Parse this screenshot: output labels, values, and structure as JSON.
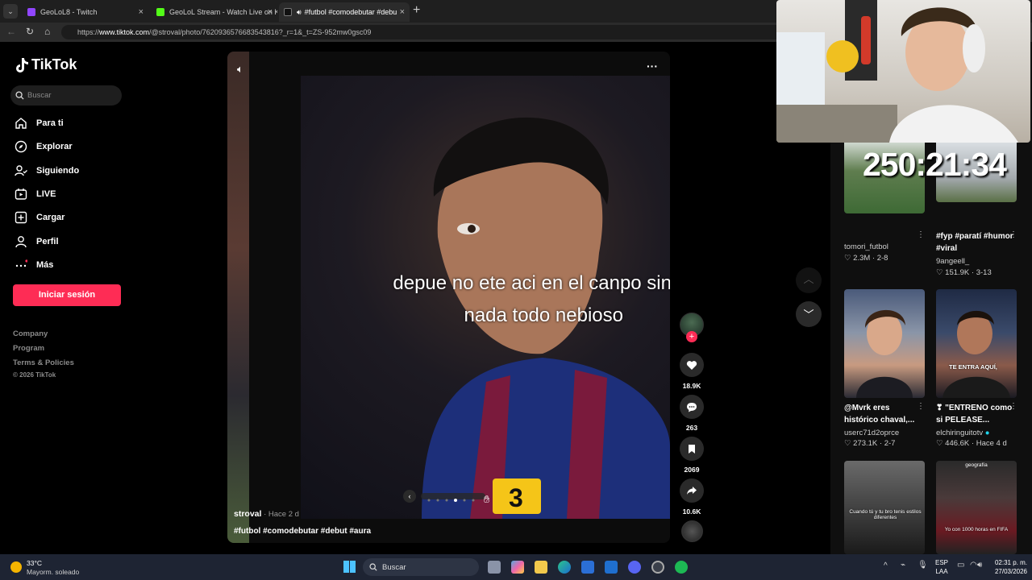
{
  "browser": {
    "tabs": [
      {
        "label": "GeoLoL8 - Twitch",
        "color": "#9146ff"
      },
      {
        "label": "GeoLoL Stream - Watch Live on Ki",
        "color": "#53fc18"
      },
      {
        "label": "#futbol #comodebutar #debu",
        "color": "#ffffff"
      }
    ],
    "new_tab": "+",
    "close_glyph": "×",
    "url_prefix": "https://",
    "url_host": "www.tiktok.com",
    "url_path": "/@stroval/photo/7620936576683543816?_r=1&_t=ZS-952mw0gsc09"
  },
  "tiktok": {
    "logo": "TikTok",
    "search_placeholder": "Buscar",
    "nav": [
      {
        "label": "Para ti",
        "icon": "home-icon"
      },
      {
        "label": "Explorar",
        "icon": "compass-icon"
      },
      {
        "label": "Siguiendo",
        "icon": "following-icon"
      },
      {
        "label": "LIVE",
        "icon": "live-icon"
      },
      {
        "label": "Cargar",
        "icon": "upload-icon"
      },
      {
        "label": "Perfil",
        "icon": "profile-icon"
      },
      {
        "label": "Más",
        "icon": "more-icon"
      }
    ],
    "login_button": "Iniciar sesión",
    "footer": [
      "Company",
      "Program",
      "Terms & Policies",
      "© 2026 TikTok"
    ],
    "post": {
      "caption_lines": [
        "depue no ete aci en el canpo sin",
        "nada todo nebioso"
      ],
      "author": "stroval",
      "time": " · Hace 2 d",
      "hashtags": "#futbol #comodebutar #debut #aura",
      "likes": "18.9K",
      "comments": "263",
      "saves": "2069",
      "shares": "10.6K",
      "dots_total": 6,
      "dots_active": 3
    },
    "timer": "250:21:34",
    "cards": [
      {
        "title": "",
        "user": "tomori_futbol",
        "stats": "2.3M · 2-8"
      },
      {
        "title": "#fyp #paratí #humor #viral",
        "user": "9angeell_",
        "stats": "151.9K · 3-13"
      },
      {
        "title": "@Mvrk eres histórico chaval,...",
        "user": "userc71d2oprce",
        "stats": "273.1K · 2-7"
      },
      {
        "title": "❣ \"ENTRENO como si PELEASE...",
        "user": "elchiringuitotv",
        "stats": "446.6K · Hace 4 d"
      }
    ],
    "thumb_texts": {
      "t2": "TE ENTRA AQUÍ,",
      "t3": "Cuando tú y tu bro tenis estilos diferentes",
      "t4_top": "geografía",
      "t4": "Yo con 1000 horas en FIFA"
    }
  },
  "taskbar": {
    "temp": "33°C",
    "weather": "Mayorm. soleado",
    "search": "Buscar",
    "lang": "ESP",
    "lang2": "LAA",
    "time": "02:31 p. m.",
    "date": "27/03/2026"
  },
  "colors": {
    "accent": "#fe2c55",
    "bg": "#000000"
  }
}
